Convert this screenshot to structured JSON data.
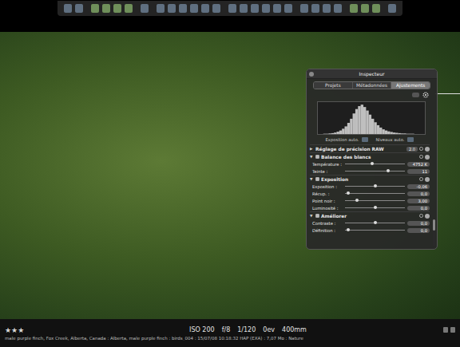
{
  "inspector": {
    "title": "Inspecteur",
    "tabs": [
      {
        "label": "Projets",
        "selected": false
      },
      {
        "label": "Métadonnées",
        "selected": false
      },
      {
        "label": "Ajustements",
        "selected": true
      }
    ],
    "histogram": {
      "values": [
        0,
        0,
        1,
        1,
        2,
        3,
        5,
        8,
        12,
        18,
        26,
        38,
        52,
        70,
        85,
        95,
        100,
        92,
        80,
        66,
        52,
        40,
        30,
        22,
        16,
        12,
        9,
        7,
        5,
        4,
        3,
        2,
        2,
        1,
        1,
        1,
        0,
        0,
        0,
        0
      ]
    },
    "auto_buttons": [
      {
        "label": "Exposition auto."
      },
      {
        "label": "Niveaux auto."
      }
    ],
    "sections": [
      {
        "title": "Réglage de précision RAW",
        "kind": "plain",
        "checked": false,
        "expanded": false,
        "disclosure": "▶",
        "version": "2.0",
        "rows": []
      },
      {
        "title": "Balance des blancs",
        "kind": "checkbox",
        "checked": true,
        "expanded": true,
        "disclosure": "▼",
        "version": "",
        "rows": [
          {
            "label": "Température :",
            "level": 0.45,
            "value": "4752 K"
          },
          {
            "label": "Teinte :",
            "level": 0.72,
            "value": "11"
          }
        ]
      },
      {
        "title": "Exposition",
        "kind": "checkbox",
        "checked": true,
        "expanded": true,
        "disclosure": "▼",
        "version": "",
        "rows": [
          {
            "label": "Exposition :",
            "level": 0.5,
            "value": "-0,06"
          },
          {
            "label": "Récup. :",
            "level": 0.05,
            "value": "0,0"
          },
          {
            "label": "Point noir :",
            "level": 0.2,
            "value": "3,00"
          },
          {
            "label": "Luminosité :",
            "level": 0.5,
            "value": "0,0"
          }
        ]
      },
      {
        "title": "Améliorer",
        "kind": "checkbox",
        "checked": true,
        "expanded": true,
        "disclosure": "▼",
        "version": "",
        "rows": [
          {
            "label": "Contraste :",
            "level": 0.5,
            "value": "0,0"
          },
          {
            "label": "Définition :",
            "level": 0.05,
            "value": "0,0"
          }
        ]
      }
    ]
  },
  "status_bar": {
    "stars": 3,
    "star_glyph": "★",
    "exif": [
      "ISO 200",
      "f/8",
      "1/120",
      "0ev",
      "400mm"
    ],
    "metadata": "male purple finch, Fox Creek, Alberta, Canada : Alberta, male purple finch : birds_004 : 15/07/08 10:18:32 HAP (EXA) : 7,07 Mo : Nature"
  }
}
